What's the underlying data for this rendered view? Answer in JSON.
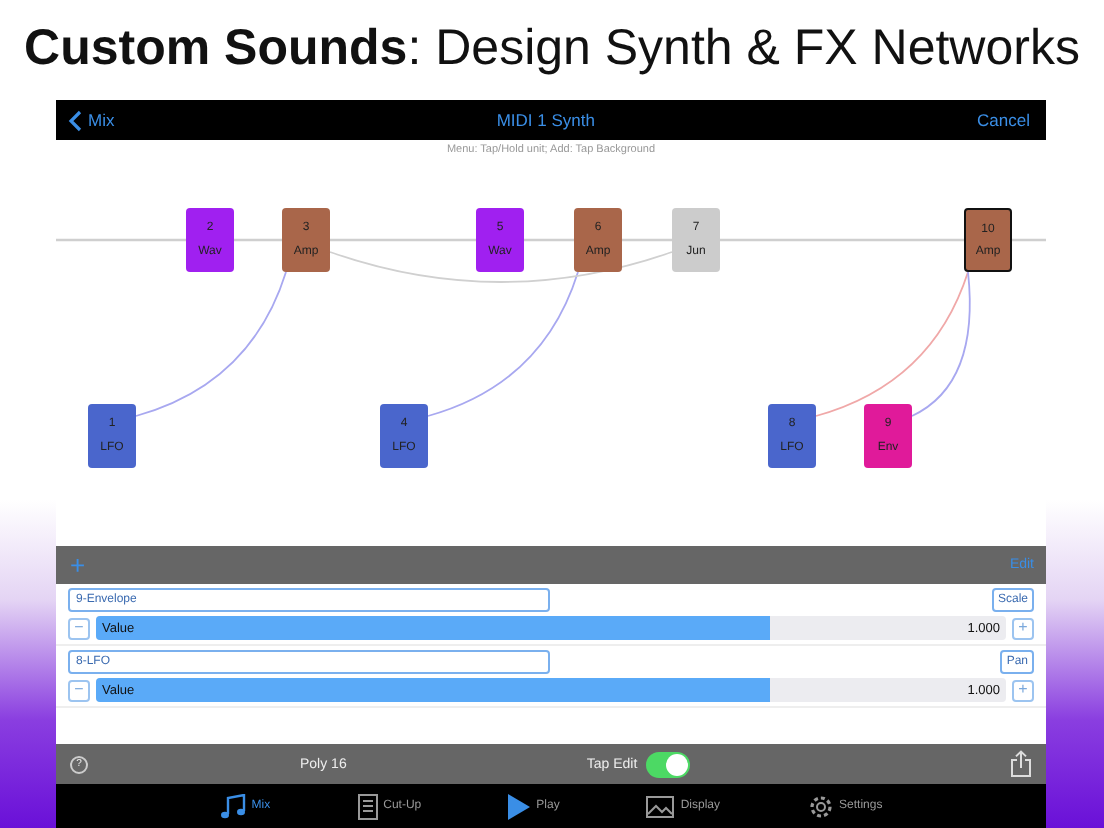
{
  "headline": "**Custom Sounds**: Design Synth & FX Networks",
  "nav": {
    "back": "Mix",
    "title": "MIDI 1 Synth",
    "action": "Cancel"
  },
  "hint": "Menu: Tap/Hold unit; Add: Tap Background",
  "nodes": [
    {
      "number": "2",
      "label": "Wav",
      "color": "#a020f0",
      "selected": false
    },
    {
      "number": "3",
      "label": "Amp",
      "color": "#a9664a",
      "selected": false
    },
    {
      "number": "5",
      "label": "Wav",
      "color": "#a020f0",
      "selected": false
    },
    {
      "number": "6",
      "label": "Amp",
      "color": "#a9664a",
      "selected": false
    },
    {
      "number": "7",
      "label": "Jun",
      "color": "#cccccc",
      "selected": false
    },
    {
      "number": "10",
      "label": "Amp",
      "color": "#a9664a",
      "selected": true
    },
    {
      "number": "1",
      "label": "LFO",
      "color": "#4a66cc",
      "selected": false
    },
    {
      "number": "4",
      "label": "LFO",
      "color": "#4a66cc",
      "selected": false
    },
    {
      "number": "8",
      "label": "LFO",
      "color": "#4a66cc",
      "selected": false
    },
    {
      "number": "9",
      "label": "Env",
      "color": "#e01a9a",
      "selected": false
    }
  ],
  "toolbar": {
    "add": "+",
    "edit": "Edit"
  },
  "params": [
    {
      "source": "9-Envelope",
      "target": "Scale",
      "label": "Value",
      "level": 0.74,
      "value": "1.000",
      "minus": "−",
      "plus": "+"
    },
    {
      "source": "8-LFO",
      "target": "Pan",
      "label": "Value",
      "level": 0.74,
      "value": "1.000",
      "minus": "−",
      "plus": "+"
    }
  ],
  "bottom": {
    "help": "?",
    "poly": "Poly 16",
    "tap_edit": "Tap Edit",
    "tap_edit_on": true
  },
  "tabs": [
    {
      "label": "Mix",
      "kind": "note",
      "selected": true
    },
    {
      "label": "Cut-Up",
      "kind": "page",
      "selected": false
    },
    {
      "label": "Play",
      "kind": "play",
      "selected": false
    },
    {
      "label": "Display",
      "kind": "image",
      "selected": false
    },
    {
      "label": "Settings",
      "kind": "gear",
      "selected": false
    }
  ]
}
